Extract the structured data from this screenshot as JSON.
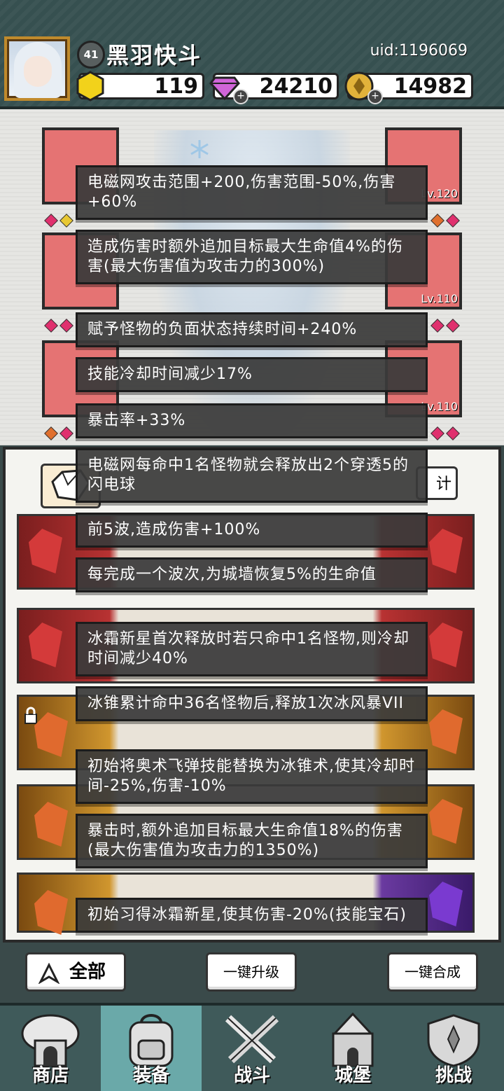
{
  "player": {
    "level": "41",
    "name": "黑羽快斗",
    "uid": "uid:1196069"
  },
  "resources": {
    "coin": "119",
    "gem": "24210",
    "gold": "14982"
  },
  "equipment": {
    "levels": [
      "Lv.120",
      "Lv.110",
      "Lv.110"
    ],
    "hidden_code": "E081"
  },
  "panel": {
    "stats_label": "计"
  },
  "tooltips": [
    "电磁网攻击范围+200,伤害范围-50%,伤害+60%",
    "造成伤害时额外追加目标最大生命值4%的伤害(最大伤害值为攻击力的300%)",
    "赋予怪物的负面状态持续时间+240%",
    "技能冷却时间减少17%",
    "暴击率+33%",
    "电磁网每命中1名怪物就会释放出2个穿透5的闪电球",
    "前5波,造成伤害+100%",
    "每完成一个波次,为城墙恢复5%的生命值",
    "冰霜新星首次释放时若只命中1名怪物,则冷却时间减少40%",
    "冰锥累计命中36名怪物后,释放1次冰风暴VII",
    "初始将奥术飞弹技能替换为冰锥术,使其冷却时间-25%,伤害-10%",
    "暴击时,额外追加目标最大生命值18%的伤害(最大伤害值为攻击力的1350%)",
    "初始习得冰霜新星,使其伤害-20%(技能宝石)"
  ],
  "actions": {
    "filter_all": "全部",
    "upgrade_all": "一键升级",
    "merge_all": "一键合成"
  },
  "nav": [
    {
      "label": "商店",
      "icon": "shop-icon"
    },
    {
      "label": "装备",
      "icon": "backpack-icon"
    },
    {
      "label": "战斗",
      "icon": "swords-icon"
    },
    {
      "label": "城堡",
      "icon": "castle-icon"
    },
    {
      "label": "挑战",
      "icon": "shield-icon"
    }
  ],
  "colors": {
    "tooltip_bg": "#3a3a3a",
    "nav_active": "#6aa9a9",
    "slot_red": "#e57373"
  }
}
